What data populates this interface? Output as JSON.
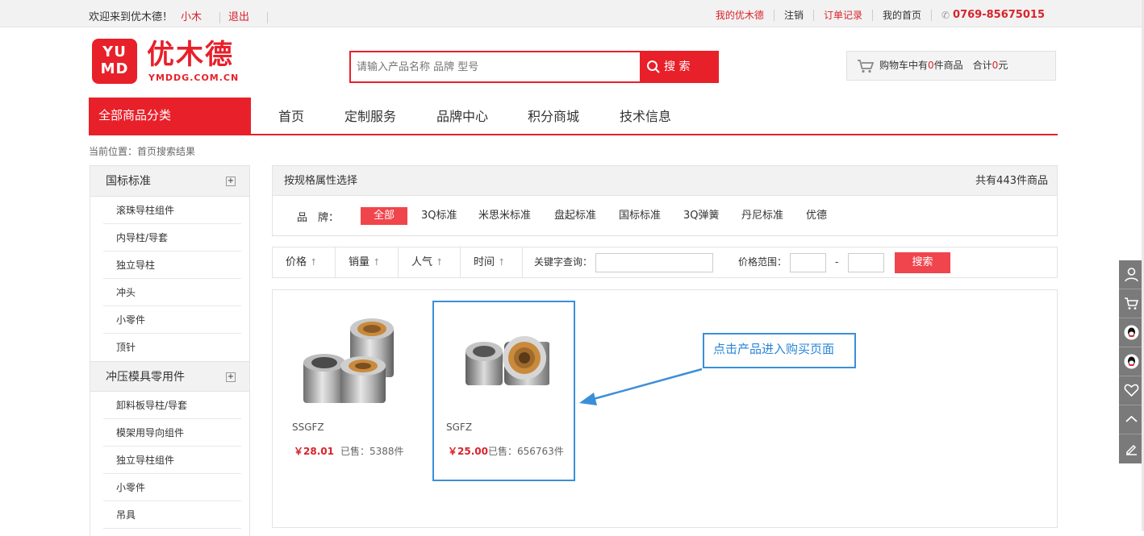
{
  "topbar": {
    "welcome": "欢迎来到优木德！",
    "user": "小木",
    "logout": "退出",
    "my_ymd": "我的优木德",
    "cancel": "注销",
    "orders": "订单记录",
    "my_home": "我的首页",
    "phone": "0769-85675015"
  },
  "logo": {
    "badge_line1": "YU",
    "badge_line2": "MD",
    "name": "优木德",
    "url": "YMDDG.COM.CN"
  },
  "search": {
    "placeholder": "请输入产品名称 品牌 型号",
    "button": "搜 索"
  },
  "cart": {
    "prefix": "购物车中有",
    "count": "0",
    "mid": "件商品　合计",
    "total": "0",
    "suffix": "元"
  },
  "nav": {
    "all_categories": "全部商品分类",
    "items": [
      "首页",
      "定制服务",
      "品牌中心",
      "积分商城",
      "技术信息"
    ]
  },
  "breadcrumb": "当前位置：首页搜索结果",
  "sidebar": {
    "groups": [
      {
        "title": "国标标准",
        "items": [
          "滚珠导柱组件",
          "内导柱/导套",
          "独立导柱",
          "冲头",
          "小零件",
          "顶针"
        ]
      },
      {
        "title": "冲压模具零用件",
        "items": [
          "卸料板导柱/导套",
          "模架用导向组件",
          "独立导柱组件",
          "小零件",
          "吊具"
        ]
      }
    ]
  },
  "spec": {
    "title": "按规格属性选择",
    "count": "共有443件商品",
    "brand_label": "品　牌：",
    "brands": [
      "全部",
      "3Q标准",
      "米思米标准",
      "盘起标准",
      "国标标准",
      "3Q弹簧",
      "丹尼标准",
      "优德"
    ]
  },
  "sort": {
    "price": "价格",
    "sales": "销量",
    "popularity": "人气",
    "time": "时间",
    "keyword_label": "关键字查询：",
    "keyword_value": "",
    "range_label": "价格范围：",
    "range_dash": "-",
    "search_button": "搜索"
  },
  "products": [
    {
      "code": "SSGFZ",
      "price": "￥28.01",
      "sold": "已售：5388件"
    },
    {
      "code": "SGFZ",
      "price": "￥25.00",
      "sold": "已售：656763件"
    }
  ],
  "callout": "点击产品进入购买页面",
  "colors": {
    "brand_red": "#e8202a",
    "highlight_blue": "#3b8fd8"
  }
}
